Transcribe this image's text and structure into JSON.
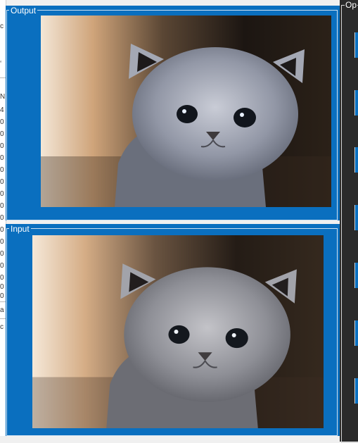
{
  "panels": {
    "output": {
      "label": "Output"
    },
    "input": {
      "label": "Input"
    },
    "options": {
      "label": "Op"
    }
  },
  "left_list": {
    "chars": [
      "c",
      "‘",
      "N",
      "4",
      "0",
      "0",
      "0",
      "0",
      "0",
      "0",
      "0",
      "0",
      "0",
      "0",
      "0",
      "0",
      "0",
      "0",
      "0",
      "0",
      "a",
      "c"
    ]
  },
  "colors": {
    "panel_blue": "#0a6fbf",
    "options_dark": "#2a2a2a"
  }
}
